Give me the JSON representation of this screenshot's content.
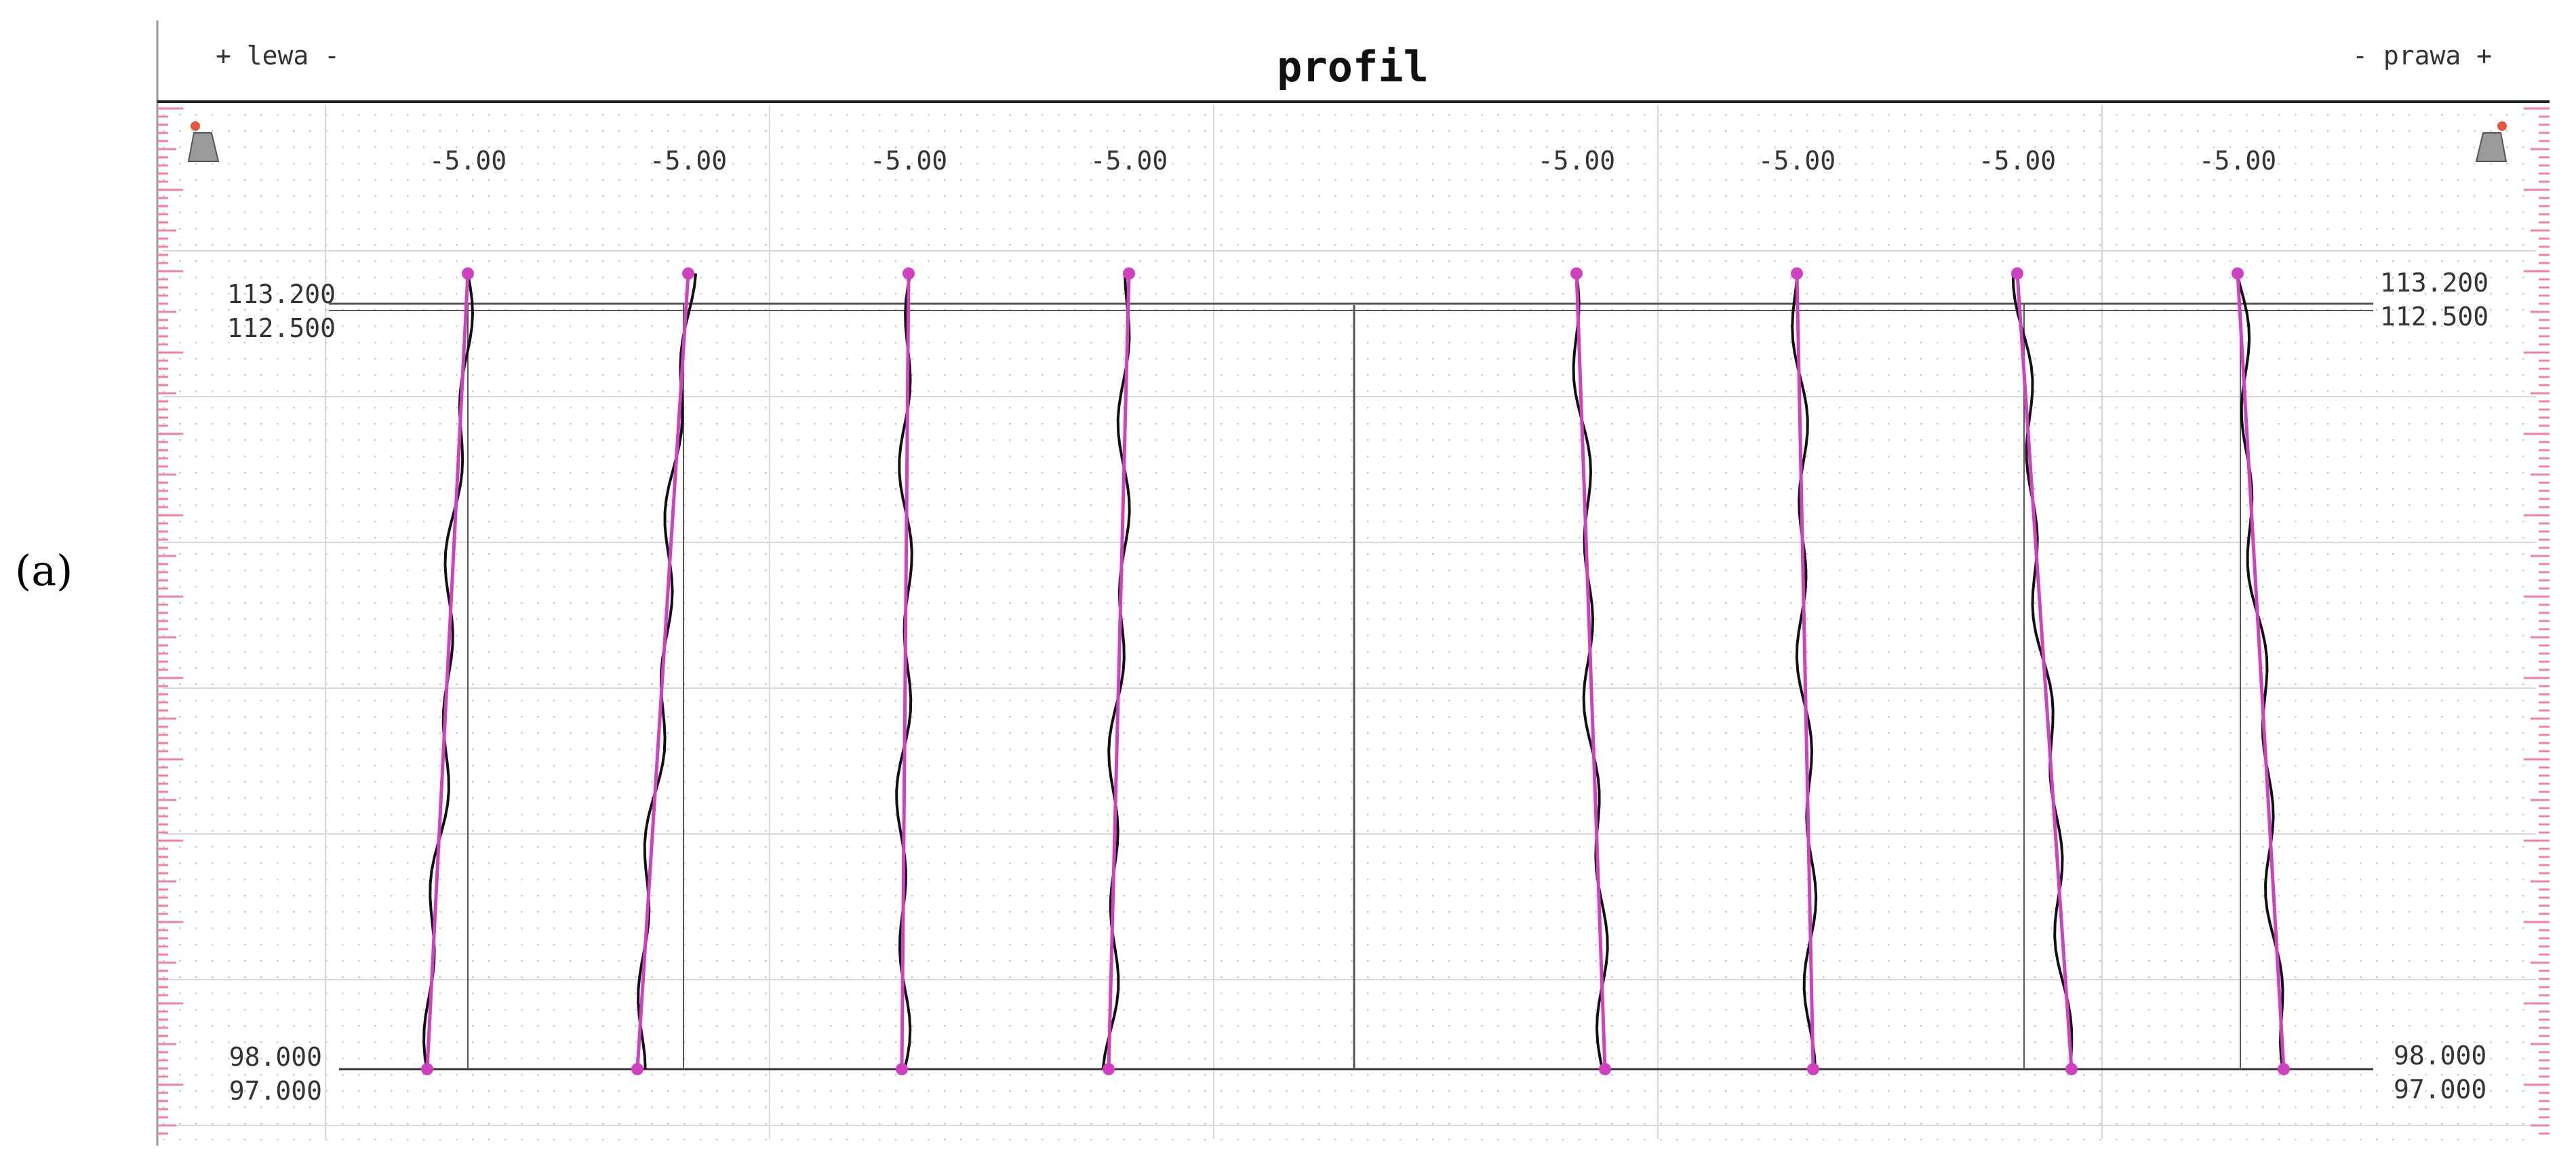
{
  "figure_label": "(a)",
  "chart_data": {
    "type": "line",
    "title": "profil",
    "left_label": "+ lewa -",
    "right_label": "- prawa +",
    "column_labels": [
      "-5.00",
      "-5.00",
      "-5.00",
      "-5.00",
      "-5.00",
      "-5.00",
      "-5.00",
      "-5.00"
    ],
    "elevation_labels_left": [
      "113.200",
      "112.500",
      "98.000",
      "97.000"
    ],
    "elevation_labels_right": [
      "113.200",
      "112.500",
      "98.000",
      "97.000"
    ],
    "ylim": [
      97.0,
      113.2
    ],
    "grid": true,
    "colors": {
      "measured": "#111111",
      "design": "#d040c0",
      "ruler": "#f080a0",
      "grid": "#c8c8c8",
      "reference": "#555555"
    },
    "series": [
      {
        "top": 113.8,
        "bottom": 98.0,
        "ref": 112.5
      },
      {
        "top": 113.8,
        "bottom": 98.0,
        "ref": 112.5
      },
      {
        "top": 113.8,
        "bottom": 98.0,
        "ref": 112.5
      },
      {
        "top": 113.8,
        "bottom": 98.0,
        "ref": 112.5
      },
      {
        "top": 113.8,
        "bottom": 98.0,
        "ref": 112.5
      },
      {
        "top": 113.8,
        "bottom": 98.0,
        "ref": 112.5
      },
      {
        "top": 113.8,
        "bottom": 98.0,
        "ref": 112.5
      },
      {
        "top": 113.8,
        "bottom": 98.0,
        "ref": 112.5
      }
    ]
  }
}
